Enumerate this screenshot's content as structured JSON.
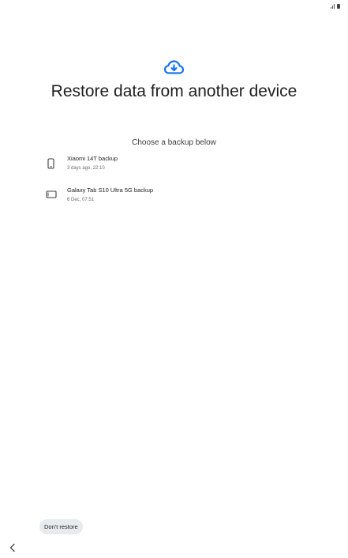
{
  "status_bar": {
    "signal_icon": "signal-icon",
    "battery_icon": "battery-icon"
  },
  "header": {
    "icon": "cloud-download-icon",
    "icon_color": "#1a73e8",
    "title": "Restore data from another device",
    "subtitle": "Choose a backup below"
  },
  "backups": [
    {
      "icon": "phone-icon",
      "title": "Xiaomi 14T backup",
      "date": "3 days ago, 22:10"
    },
    {
      "icon": "tablet-icon",
      "title": "Galaxy Tab S10 Ultra 5G backup",
      "date": "6 Dec, 07:51"
    }
  ],
  "footer": {
    "dont_restore_label": "Don't restore",
    "back_icon": "back-chevron-icon"
  }
}
